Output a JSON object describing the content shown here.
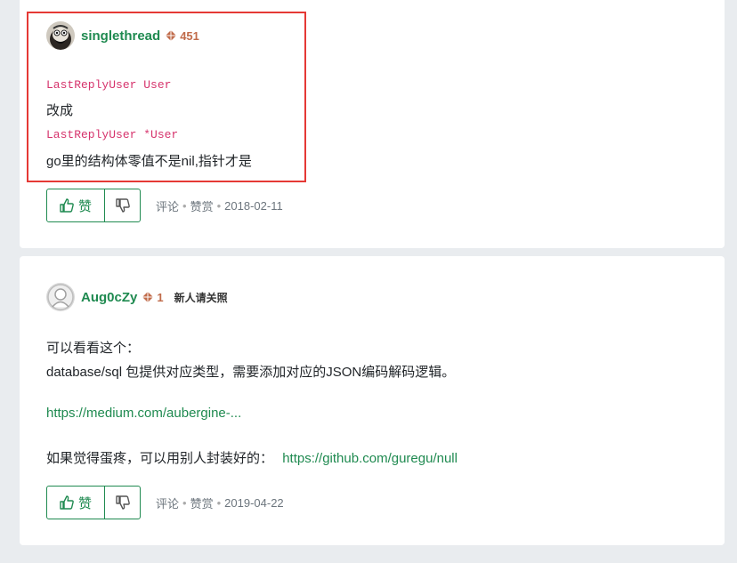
{
  "reply1": {
    "username": "singlethread",
    "reputation": "451",
    "code1": "LastReplyUser User",
    "text1": "改成",
    "code2": "LastReplyUser *User",
    "text2": "go里的结构体零值不是nil,指针才是",
    "like_label": "赞",
    "comment_label": "评论",
    "reward_label": "赞赏",
    "date": "2018-02-11"
  },
  "reply2": {
    "username": "Aug0cZy",
    "reputation": "1",
    "badge": "新人请关照",
    "line1": "可以看看这个：",
    "line2": "database/sql 包提供对应类型，需要添加对应的JSON编码解码逻辑。",
    "link1": "https://medium.com/aubergine-...",
    "line3_prefix": "如果觉得蛋疼，可以用别人封装好的：",
    "link2": "https://github.com/guregu/null",
    "like_label": "赞",
    "comment_label": "评论",
    "reward_label": "赞赏",
    "date": "2019-04-22"
  },
  "colors": {
    "username": "#1f8a50",
    "reputation": "#c06b4a",
    "code": "#d6336c",
    "highlight_border": "#e53935",
    "background": "#e9ecef"
  }
}
